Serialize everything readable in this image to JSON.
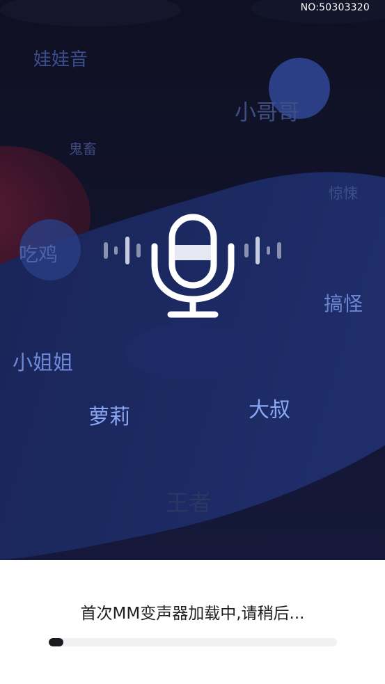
{
  "header": {
    "serial_number": "NO:50303320"
  },
  "voice_tags": [
    {
      "id": "wawayin",
      "label": "娃娃音",
      "color": "#3a4d8f"
    },
    {
      "id": "xiaogege",
      "label": "小哥哥",
      "color": "#3f4f86"
    },
    {
      "id": "guichu",
      "label": "鬼畜",
      "color": "#3e4a7e"
    },
    {
      "id": "jingsong",
      "label": "惊悚",
      "color": "#3d4f8c"
    },
    {
      "id": "chiji",
      "label": "吃鸡",
      "color": "#4d62a8"
    },
    {
      "id": "gaoguai",
      "label": "搞怪",
      "color": "#6c86d4"
    },
    {
      "id": "xiaojiejie",
      "label": "小姐姐",
      "color": "#6f8ad8"
    },
    {
      "id": "luoli",
      "label": "萝莉",
      "color": "#8aa6f2"
    },
    {
      "id": "dashu",
      "label": "大叔",
      "color": "#8aa8f5"
    },
    {
      "id": "wangzhe",
      "label": "王者",
      "color": "#2c3563"
    }
  ],
  "loading": {
    "message": "首次MM变声器加载中,请稍后...",
    "progress_percent": 5
  },
  "colors": {
    "background": "#111226",
    "wave": "#1a2a5e",
    "accent_red": "#4a1a2e",
    "mic": "#ffffff"
  }
}
